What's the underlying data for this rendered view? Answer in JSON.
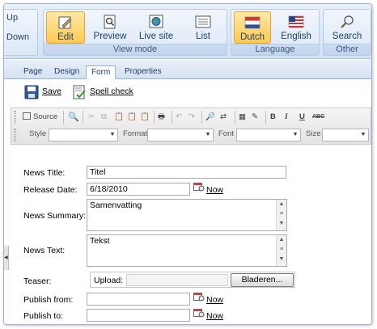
{
  "ribbon": {
    "left_group": {
      "up": "Up",
      "down": "Down"
    },
    "view_mode": {
      "label": "View mode",
      "buttons": [
        {
          "label": "Edit",
          "icon": "pencil-icon",
          "active": true
        },
        {
          "label": "Preview",
          "icon": "magnifier-page-icon",
          "active": false
        },
        {
          "label": "Live site",
          "icon": "globe-icon",
          "active": false
        },
        {
          "label": "List",
          "icon": "list-icon",
          "active": false
        }
      ]
    },
    "language": {
      "label": "Language",
      "buttons": [
        {
          "label": "Dutch",
          "icon": "dutch-flag-icon",
          "active": true
        },
        {
          "label": "English",
          "icon": "us-flag-icon",
          "active": false
        }
      ]
    },
    "other": {
      "label": "Other",
      "buttons": [
        {
          "label": "Search",
          "icon": "search-icon",
          "active": false
        }
      ]
    }
  },
  "tabs": [
    {
      "label": "Page",
      "active": false
    },
    {
      "label": "Design",
      "active": false
    },
    {
      "label": "Form",
      "active": true
    },
    {
      "label": "Properties",
      "active": false
    }
  ],
  "savebar": {
    "save": "Save",
    "spellcheck": "Spell check"
  },
  "editor_toolbar": {
    "source": "Source",
    "style_label": "Style",
    "format_label": "Format",
    "font_label": "Font",
    "size_label": "Size",
    "bold": "B",
    "italic": "I",
    "underline": "U",
    "strike": "ABC"
  },
  "form": {
    "news_title": {
      "label": "News Title:",
      "value": "Titel"
    },
    "release_date": {
      "label": "Release Date:",
      "value": "6/18/2010",
      "now": "Now"
    },
    "news_summary": {
      "label": "News Summary:",
      "value": "Samenvatting"
    },
    "news_text": {
      "label": "News Text:",
      "value": "Tekst"
    },
    "teaser": {
      "label": "Teaser:",
      "upload_label": "Upload:",
      "browse_button": "Bladeren..."
    },
    "publish_from": {
      "label": "Publish from:",
      "value": "",
      "now": "Now"
    },
    "publish_to": {
      "label": "Publish to:",
      "value": "",
      "now": "Now"
    }
  },
  "colors": {
    "ribbon_active": "#ffc94f",
    "ribbon_text": "#21406b",
    "frame_border": "#9fb3cc"
  }
}
